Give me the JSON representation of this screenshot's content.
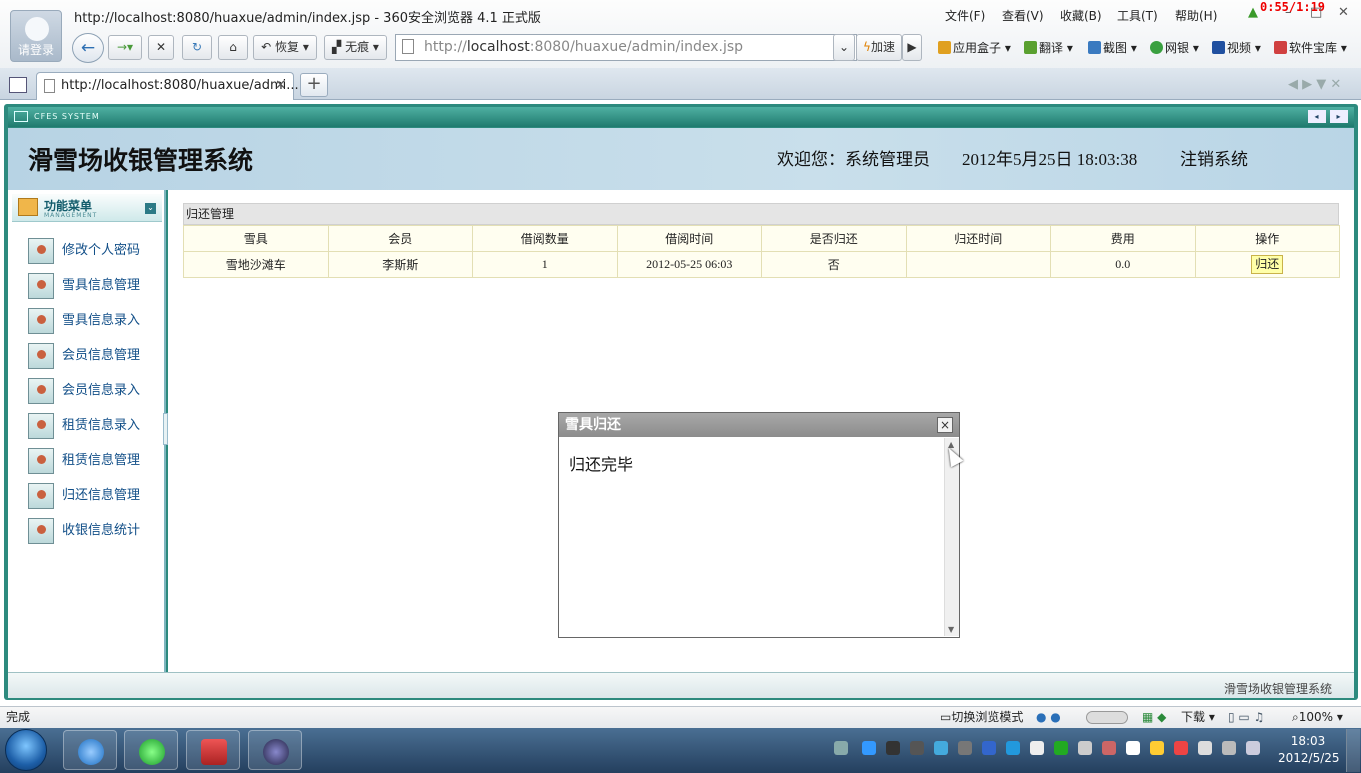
{
  "browser": {
    "window_title": "http://localhost:8080/huaxue/admin/index.jsp - 360安全浏览器 4.1 正式版",
    "user_label": "请登录",
    "timer": "0:55/1:19",
    "menu": [
      "文件(F)",
      "查看(V)",
      "收藏(B)",
      "工具(T)",
      "帮助(H)"
    ],
    "nav": {
      "restore": "恢复",
      "notrace": "无痕",
      "speedup": "加速"
    },
    "address": {
      "prefix": "http://",
      "host": "localhost",
      "path": ":8080/huaxue/admin/index.jsp"
    },
    "toolbar": [
      "应用盒子",
      "翻译",
      "截图",
      "网银",
      "视频",
      "软件宝库"
    ],
    "tab_title": "http://localhost:8080/huaxue/admi...",
    "status": "完成",
    "status_right": {
      "mode": "切换浏览模式",
      "download": "下载",
      "zoom": "100%"
    }
  },
  "app": {
    "frame_label": "CFES SYSTEM",
    "title": "滑雪场收银管理系统",
    "welcome": "欢迎您：系统管理员",
    "datetime": "2012年5月25日  18:03:38",
    "logout": "注销系统",
    "footer": "滑雪场收银管理系统"
  },
  "sidebar": {
    "title": "功能菜单",
    "subtitle": "MANAGEMENT",
    "items": [
      "修改个人密码",
      "雪具信息管理",
      "雪具信息录入",
      "会员信息管理",
      "会员信息录入",
      "租赁信息录入",
      "租赁信息管理",
      "归还信息管理",
      "收银信息统计"
    ]
  },
  "panel": {
    "title": "归还管理",
    "columns": [
      "雪具",
      "会员",
      "借阅数量",
      "借阅时间",
      "是否归还",
      "归还时间",
      "费用",
      "操作"
    ],
    "rows": [
      {
        "item": "雪地沙滩车",
        "member": "李斯斯",
        "qty": "1",
        "time": "2012-05-25 06:03",
        "returned": "否",
        "return_time": "",
        "fee": "0.0",
        "action": "归还"
      }
    ]
  },
  "dialog": {
    "title": "雪具归还",
    "message": "归还完毕",
    "close": "×"
  },
  "taskbar": {
    "time": "18:03",
    "date": "2012/5/25"
  }
}
